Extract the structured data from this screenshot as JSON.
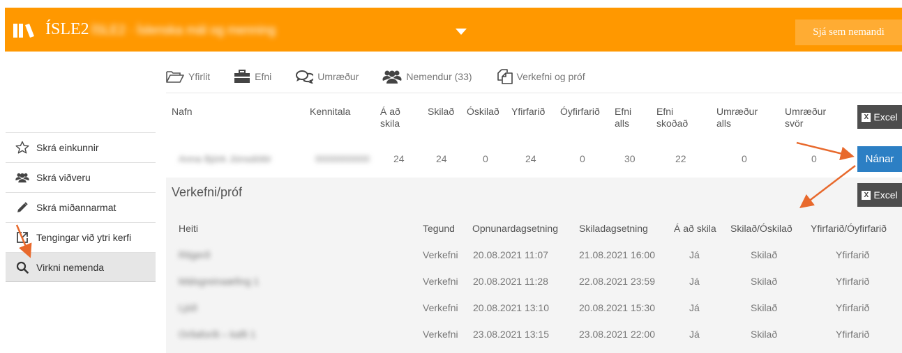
{
  "header": {
    "brand": "ÍSLE2",
    "course_title": "ÍSLE2 · Íslenska mál og menning",
    "view_as_student": "Sjá sem nemandi"
  },
  "tabs": [
    {
      "label": "Yfirlit",
      "icon": "folder-open-icon"
    },
    {
      "label": "Efni",
      "icon": "briefcase-icon"
    },
    {
      "label": "Umræður",
      "icon": "comments-icon"
    },
    {
      "label": "Nemendur (33)",
      "icon": "users-icon"
    },
    {
      "label": "Verkefni og próf",
      "icon": "copy-icon"
    }
  ],
  "sidebar": {
    "items": [
      {
        "label": "Skrá einkunnir",
        "icon": "star-icon"
      },
      {
        "label": "Skrá viðveru",
        "icon": "users-icon"
      },
      {
        "label": "Skrá miðannarmat",
        "icon": "pencil-icon"
      },
      {
        "label": "Tengingar við ytri kerfi",
        "icon": "external-link-icon"
      },
      {
        "label": "Virkni nemenda",
        "icon": "search-icon"
      }
    ]
  },
  "summary": {
    "headers": {
      "name": "Nafn",
      "kennitala": "Kennitala",
      "due_1": "Á að",
      "due_2": "skila",
      "submitted": "Skilað",
      "unsubmitted": "Óskilað",
      "reviewed": "Yfirfarið",
      "unreviewed": "Óyfirfarið",
      "material_1": "Efni",
      "material_2": "alls",
      "viewed_1": "Efni",
      "viewed_2": "skoðað",
      "disc_1": "Umræður",
      "disc_2": "alls",
      "replies_1": "Umræður",
      "replies_2": "svör"
    },
    "row": {
      "name": "Anna Björk Jónsdóttir",
      "kennitala": "0000000000",
      "due": "24",
      "submitted": "24",
      "unsubmitted": "0",
      "reviewed": "24",
      "unreviewed": "0",
      "material": "30",
      "viewed": "22",
      "discussions": "0",
      "replies": "0"
    },
    "excel_label": "Excel",
    "details_label": "Nánar"
  },
  "assignments": {
    "title": "Verkefni/próf",
    "excel_label": "Excel",
    "headers": {
      "name": "Heiti",
      "type": "Tegund",
      "open": "Opnunardagsetning",
      "due_date": "Skiladagsetning",
      "to_submit": "Á að skila",
      "status": "Skilað/Óskilað",
      "review": "Yfirfarið/Óyfirfarið"
    },
    "rows": [
      {
        "name": "Ritgerð",
        "type": "Verkefni",
        "open": "20.08.2021 11:07",
        "due": "21.08.2021 16:00",
        "to_submit": "Já",
        "status": "Skilað",
        "review": "Yfirfarið"
      },
      {
        "name": "Málsgreinaæfing 1",
        "type": "Verkefni",
        "open": "20.08.2021 11:28",
        "due": "22.08.2021 23:59",
        "to_submit": "Já",
        "status": "Skilað",
        "review": "Yfirfarið"
      },
      {
        "name": "Ljóð",
        "type": "Verkefni",
        "open": "20.08.2021 13:10",
        "due": "20.08.2021 15:30",
        "to_submit": "Já",
        "status": "Skilað",
        "review": "Yfirfarið"
      },
      {
        "name": "Orðaforði – kafli 1",
        "type": "Verkefni",
        "open": "23.08.2021 13:15",
        "due": "23.08.2021 22:00",
        "to_submit": "Já",
        "status": "Skilað",
        "review": "Yfirfarið"
      }
    ]
  },
  "colors": {
    "header": "#ff9800",
    "accent_button": "#2c7fc4",
    "excel_button": "#4d4d4d",
    "arrow": "#e8692c"
  }
}
